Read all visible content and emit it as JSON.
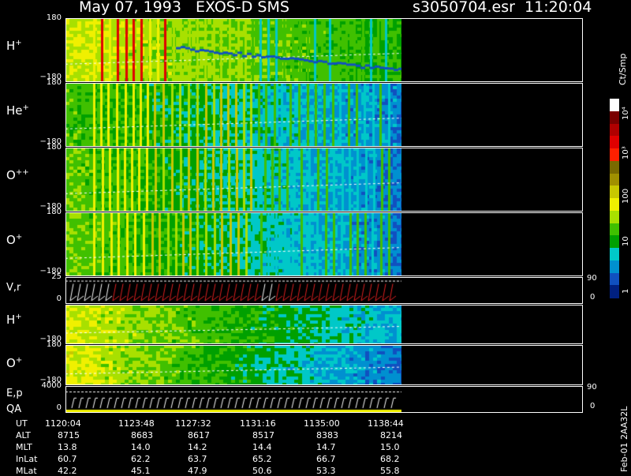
{
  "header": {
    "left_title": "May 07, 1993   EXOS-D SMS",
    "right_title": "s3050704.esr  11:20:04"
  },
  "panels": [
    {
      "id": "h1",
      "label": "H",
      "sup": "+",
      "top_tick": "180",
      "bot_tick": "−180",
      "dark": false
    },
    {
      "id": "he",
      "label": "He",
      "sup": "+",
      "top_tick": "180",
      "bot_tick": "−180",
      "dark": false
    },
    {
      "id": "opp",
      "label": "O",
      "sup": "++",
      "top_tick": "180",
      "bot_tick": "−180",
      "dark": false
    },
    {
      "id": "op1",
      "label": "O",
      "sup": "+",
      "top_tick": "180",
      "bot_tick": "−180",
      "dark": false
    },
    {
      "id": "vr",
      "label": "V,r",
      "sup": "",
      "top_tick": "25",
      "bot_tick": "0",
      "dark": true,
      "right_top": "90",
      "right_bot": "0"
    },
    {
      "id": "h2",
      "label": "H",
      "sup": "+",
      "top_tick": "",
      "bot_tick": "−180",
      "dark": false
    },
    {
      "id": "op2",
      "label": "O",
      "sup": "+",
      "top_tick": "180",
      "bot_tick": "−180",
      "dark": false
    },
    {
      "id": "ep",
      "label": "E,p",
      "sup": "",
      "top_tick": "4000",
      "bot_tick": "0",
      "dark": true,
      "right_top": "90",
      "right_bot": "0",
      "extra_label": "QA"
    }
  ],
  "colorbar": {
    "unit_label": "Ct/Smp",
    "tick_labels": [
      "10⁴",
      "10³",
      "100",
      "10",
      "1"
    ],
    "colors": [
      "#ffffff",
      "#7a0000",
      "#b00000",
      "#e00000",
      "#ff2000",
      "#7a6a00",
      "#a09000",
      "#c8c800",
      "#f0f000",
      "#a8e000",
      "#40c000",
      "#00a000",
      "#00c8c8",
      "#0090d0",
      "#1050c0",
      "#002080"
    ]
  },
  "footer": {
    "labels": [
      "UT",
      "ALT",
      "MLT",
      "InLat",
      "MLat"
    ],
    "columns": [
      [
        "1120:04",
        "8715",
        "13.8",
        "60.7",
        "42.2"
      ],
      [
        "1123:48",
        "8683",
        "14.0",
        "62.2",
        "45.1"
      ],
      [
        "1127:32",
        "8617",
        "14.2",
        "63.7",
        "47.9"
      ],
      [
        "1131:16",
        "8517",
        "14.4",
        "65.2",
        "50.6"
      ],
      [
        "1135:00",
        "8383",
        "14.7",
        "66.7",
        "53.3"
      ],
      [
        "1138:44",
        "8214",
        "15.0",
        "68.2",
        "55.8"
      ]
    ],
    "side_label": "Feb-01  2AA32L"
  },
  "chart_data": {
    "type": "heatmap",
    "x_label": "UT",
    "x_ticks": [
      "1120:04",
      "1123:48",
      "1127:32",
      "1131:16",
      "1135:00",
      "1138:44"
    ],
    "panels": [
      "H+",
      "He+",
      "O++",
      "O+",
      "V,r",
      "H+",
      "O+",
      "E,p"
    ],
    "color_scale_ticks": [
      "1",
      "10",
      "100",
      "10³",
      "10⁴"
    ],
    "color_scale_unit": "Ct/Smp",
    "data_end_fraction": 0.65
  }
}
